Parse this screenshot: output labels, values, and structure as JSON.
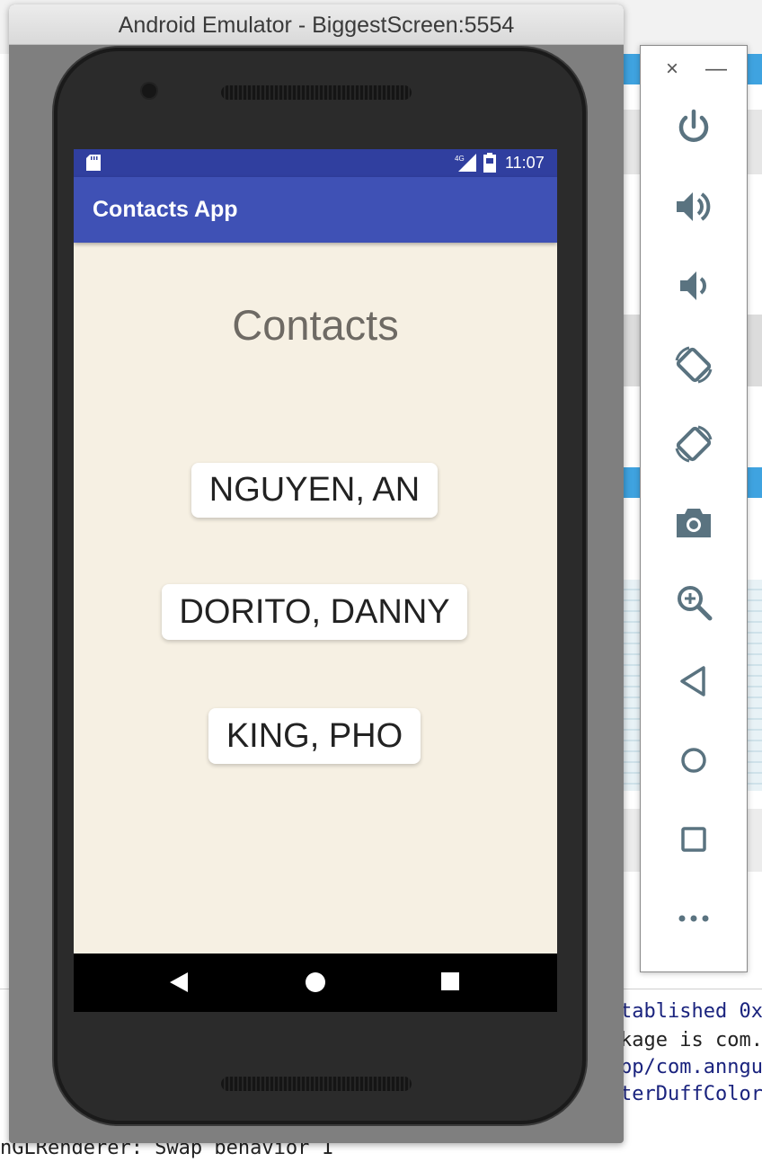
{
  "window": {
    "title": "Android Emulator - BiggestScreen:5554"
  },
  "status_bar": {
    "network": "4G",
    "time": "11:07"
  },
  "app_bar": {
    "title": "Contacts App"
  },
  "main": {
    "heading": "Contacts",
    "contacts": [
      {
        "label": "NGUYEN, AN"
      },
      {
        "label": "DORITO, DANNY"
      },
      {
        "label": "KING, PHO"
      }
    ]
  },
  "side_toolbar": {
    "close_label": "×",
    "minimize_label": "—",
    "tools": [
      {
        "name": "power-icon"
      },
      {
        "name": "volume-up-icon"
      },
      {
        "name": "volume-down-icon"
      },
      {
        "name": "rotate-left-icon"
      },
      {
        "name": "rotate-right-icon"
      },
      {
        "name": "camera-icon"
      },
      {
        "name": "zoom-icon"
      },
      {
        "name": "back-icon"
      },
      {
        "name": "home-icon"
      },
      {
        "name": "overview-icon"
      },
      {
        "name": "more-icon"
      }
    ]
  },
  "background": {
    "console_lines": [
      "tablished 0x",
      "kage is com.",
      "pp/com.anngu",
      "terDuffColor",
      "nGLRenderer: Swap behavior 1"
    ]
  },
  "colors": {
    "status_bar": "#303f9f",
    "app_bar": "#3f51b5",
    "screen_bg": "#f6f0e3",
    "toolbar_icon": "#5a7380"
  }
}
